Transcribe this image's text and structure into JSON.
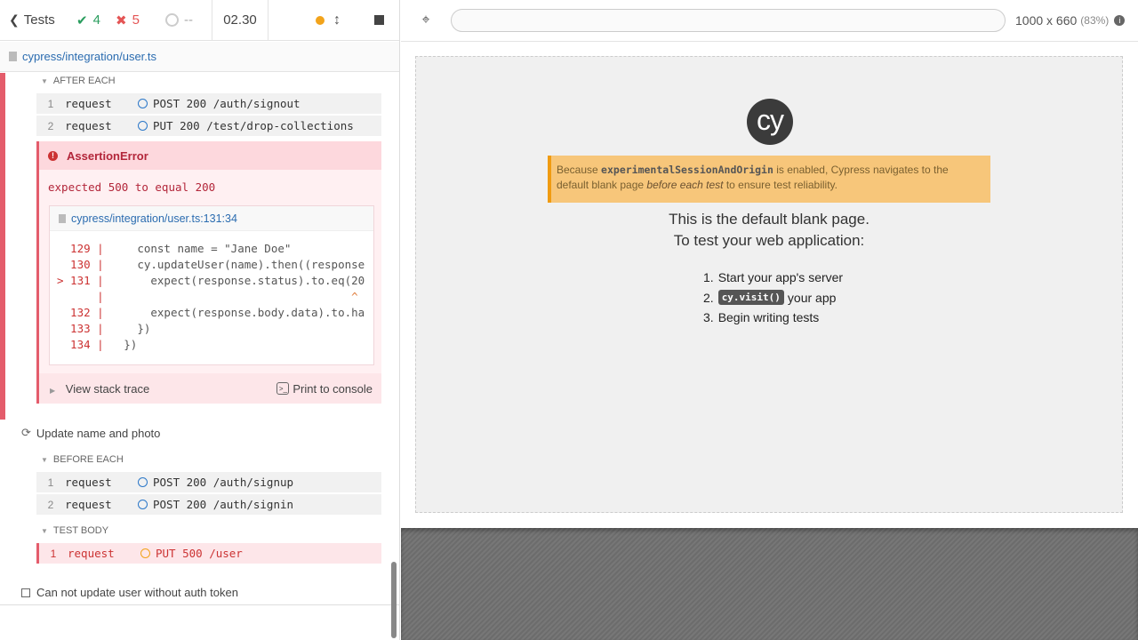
{
  "stats": {
    "tests_label": "Tests",
    "passed": "4",
    "failed": "5",
    "pending": "--",
    "duration": "02.30"
  },
  "spec": {
    "path": "cypress/integration/user.ts"
  },
  "after_each": {
    "title": "After Each",
    "commands": [
      {
        "num": "1",
        "name": "request",
        "msg": "POST 200 /auth/signout"
      },
      {
        "num": "2",
        "name": "request",
        "msg": "PUT 200 /test/drop-collections"
      }
    ]
  },
  "error": {
    "name": "AssertionError",
    "message": "expected 500 to equal 200",
    "file": "cypress/integration/user.ts:131:34",
    "code_lines": [
      {
        "ln": "  129 |",
        "code": "     const name = \"Jane Doe\""
      },
      {
        "ln": "  130 |",
        "code": "     cy.updateUser(name).then((response"
      },
      {
        "ln": "> 131 |",
        "code": "       expect(response.status).to.eq(20"
      },
      {
        "ln": "      |",
        "code": "                                     ^"
      },
      {
        "ln": "  132 |",
        "code": "       expect(response.body.data).to.ha"
      },
      {
        "ln": "  133 |",
        "code": "     })"
      },
      {
        "ln": "  134 |",
        "code": "   })"
      }
    ],
    "stack_trace_label": "View stack trace",
    "print_label": "Print to console"
  },
  "test2": {
    "title": "Update name and photo",
    "before_each_title": "Before Each",
    "before_each": [
      {
        "num": "1",
        "name": "request",
        "msg": "POST 200 /auth/signup"
      },
      {
        "num": "2",
        "name": "request",
        "msg": "POST 200 /auth/signin"
      }
    ],
    "body_title": "Test Body",
    "body": [
      {
        "num": "1",
        "name": "request",
        "msg": "PUT 500 /user"
      }
    ]
  },
  "test3": {
    "title": "Can not update user without auth token"
  },
  "aut": {
    "url": "",
    "viewport": "1000 x 660",
    "scale": "(83%)",
    "notice_pre": "Because ",
    "notice_code": "experimentalSessionAndOrigin",
    "notice_mid": " is enabled, Cypress navigates to the default blank page ",
    "notice_em": "before each test",
    "notice_post": " to ensure test reliability.",
    "blank_line1": "This is the default blank page.",
    "blank_line2": "To test your web application:",
    "steps": [
      {
        "num": "1.",
        "text": "Start your app's server"
      },
      {
        "num": "2.",
        "code": "cy.visit()",
        "text": "your app"
      },
      {
        "num": "3.",
        "text": "Begin writing tests"
      }
    ],
    "logo_text": "cy"
  },
  "colors": {
    "passed": "#2a9d5e",
    "failed": "#e45555",
    "accent": "#2b6cb0",
    "notice": "#f7c67a"
  }
}
